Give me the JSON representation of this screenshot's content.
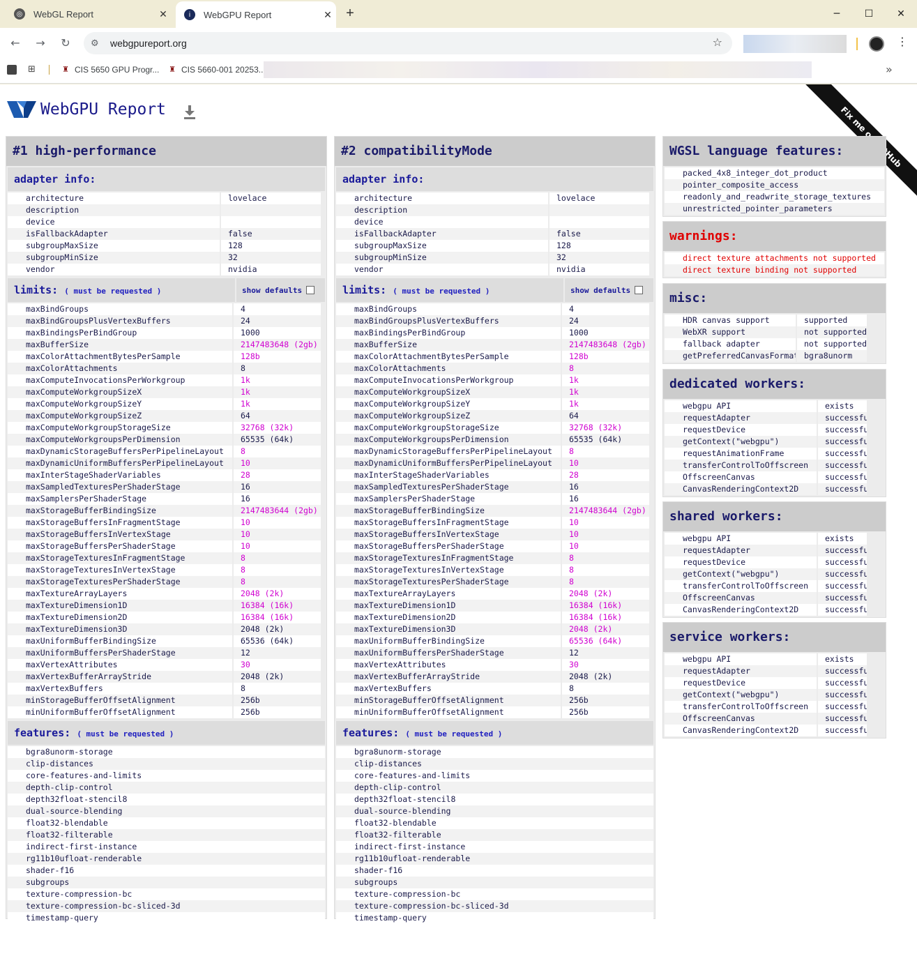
{
  "browser": {
    "tabs": [
      {
        "title": "WebGL Report",
        "active": false
      },
      {
        "title": "WebGPU Report",
        "active": true
      }
    ],
    "url": "webgpureport.org",
    "bookmarks": [
      {
        "label": "CIS 5650 GPU Progr..."
      },
      {
        "label": "CIS 5660-001 20253..."
      }
    ]
  },
  "page": {
    "title": "WebGPU Report",
    "ribbon": "Fix me on GitHub"
  },
  "adapters": [
    {
      "heading": "#1 high-performance",
      "adapter_info_label": "adapter info:",
      "adapter_info": [
        {
          "k": "architecture",
          "v": "lovelace"
        },
        {
          "k": "description",
          "v": ""
        },
        {
          "k": "device",
          "v": ""
        },
        {
          "k": "isFallbackAdapter",
          "v": "false"
        },
        {
          "k": "subgroupMaxSize",
          "v": "128"
        },
        {
          "k": "subgroupMinSize",
          "v": "32"
        },
        {
          "k": "vendor",
          "v": "nvidia"
        }
      ],
      "limits_label": "limits:",
      "must_be_requested": "( must be requested )",
      "show_defaults": "show defaults",
      "limits": [
        {
          "k": "maxBindGroups",
          "v": "4",
          "hl": false
        },
        {
          "k": "maxBindGroupsPlusVertexBuffers",
          "v": "24",
          "hl": false
        },
        {
          "k": "maxBindingsPerBindGroup",
          "v": "1000",
          "hl": false
        },
        {
          "k": "maxBufferSize",
          "v": "2147483648 (2gb)",
          "hl": true
        },
        {
          "k": "maxColorAttachmentBytesPerSample",
          "v": "128b",
          "hl": true
        },
        {
          "k": "maxColorAttachments",
          "v": "8",
          "hl": false
        },
        {
          "k": "maxComputeInvocationsPerWorkgroup",
          "v": "1k",
          "hl": true
        },
        {
          "k": "maxComputeWorkgroupSizeX",
          "v": "1k",
          "hl": true
        },
        {
          "k": "maxComputeWorkgroupSizeY",
          "v": "1k",
          "hl": true
        },
        {
          "k": "maxComputeWorkgroupSizeZ",
          "v": "64",
          "hl": false
        },
        {
          "k": "maxComputeWorkgroupStorageSize",
          "v": "32768 (32k)",
          "hl": true
        },
        {
          "k": "maxComputeWorkgroupsPerDimension",
          "v": "65535 (64k)",
          "hl": false
        },
        {
          "k": "maxDynamicStorageBuffersPerPipelineLayout",
          "v": "8",
          "hl": true
        },
        {
          "k": "maxDynamicUniformBuffersPerPipelineLayout",
          "v": "10",
          "hl": true
        },
        {
          "k": "maxInterStageShaderVariables",
          "v": "28",
          "hl": true
        },
        {
          "k": "maxSampledTexturesPerShaderStage",
          "v": "16",
          "hl": false
        },
        {
          "k": "maxSamplersPerShaderStage",
          "v": "16",
          "hl": false
        },
        {
          "k": "maxStorageBufferBindingSize",
          "v": "2147483644 (2gb)",
          "hl": true
        },
        {
          "k": "maxStorageBuffersInFragmentStage",
          "v": "10",
          "hl": true
        },
        {
          "k": "maxStorageBuffersInVertexStage",
          "v": "10",
          "hl": true
        },
        {
          "k": "maxStorageBuffersPerShaderStage",
          "v": "10",
          "hl": true
        },
        {
          "k": "maxStorageTexturesInFragmentStage",
          "v": "8",
          "hl": true
        },
        {
          "k": "maxStorageTexturesInVertexStage",
          "v": "8",
          "hl": true
        },
        {
          "k": "maxStorageTexturesPerShaderStage",
          "v": "8",
          "hl": true
        },
        {
          "k": "maxTextureArrayLayers",
          "v": "2048 (2k)",
          "hl": true
        },
        {
          "k": "maxTextureDimension1D",
          "v": "16384 (16k)",
          "hl": true
        },
        {
          "k": "maxTextureDimension2D",
          "v": "16384 (16k)",
          "hl": true
        },
        {
          "k": "maxTextureDimension3D",
          "v": "2048 (2k)",
          "hl": false
        },
        {
          "k": "maxUniformBufferBindingSize",
          "v": "65536 (64k)",
          "hl": false
        },
        {
          "k": "maxUniformBuffersPerShaderStage",
          "v": "12",
          "hl": false
        },
        {
          "k": "maxVertexAttributes",
          "v": "30",
          "hl": true
        },
        {
          "k": "maxVertexBufferArrayStride",
          "v": "2048 (2k)",
          "hl": false
        },
        {
          "k": "maxVertexBuffers",
          "v": "8",
          "hl": false
        },
        {
          "k": "minStorageBufferOffsetAlignment",
          "v": "256b",
          "hl": false
        },
        {
          "k": "minUniformBufferOffsetAlignment",
          "v": "256b",
          "hl": false
        }
      ],
      "features_label": "features:",
      "features": [
        "bgra8unorm-storage",
        "clip-distances",
        "core-features-and-limits",
        "depth-clip-control",
        "depth32float-stencil8",
        "dual-source-blending",
        "float32-blendable",
        "float32-filterable",
        "indirect-first-instance",
        "rg11b10ufloat-renderable",
        "shader-f16",
        "subgroups",
        "texture-compression-bc",
        "texture-compression-bc-sliced-3d",
        "timestamp-query"
      ]
    },
    {
      "heading": "#2 compatibilityMode",
      "adapter_info_label": "adapter info:",
      "adapter_info": [
        {
          "k": "architecture",
          "v": "lovelace"
        },
        {
          "k": "description",
          "v": ""
        },
        {
          "k": "device",
          "v": ""
        },
        {
          "k": "isFallbackAdapter",
          "v": "false"
        },
        {
          "k": "subgroupMaxSize",
          "v": "128"
        },
        {
          "k": "subgroupMinSize",
          "v": "32"
        },
        {
          "k": "vendor",
          "v": "nvidia"
        }
      ],
      "limits_label": "limits:",
      "must_be_requested": "( must be requested )",
      "show_defaults": "show defaults",
      "limits": [
        {
          "k": "maxBindGroups",
          "v": "4",
          "hl": false
        },
        {
          "k": "maxBindGroupsPlusVertexBuffers",
          "v": "24",
          "hl": false
        },
        {
          "k": "maxBindingsPerBindGroup",
          "v": "1000",
          "hl": false
        },
        {
          "k": "maxBufferSize",
          "v": "2147483648 (2gb)",
          "hl": true
        },
        {
          "k": "maxColorAttachmentBytesPerSample",
          "v": "128b",
          "hl": true
        },
        {
          "k": "maxColorAttachments",
          "v": "8",
          "hl": true
        },
        {
          "k": "maxComputeInvocationsPerWorkgroup",
          "v": "1k",
          "hl": true
        },
        {
          "k": "maxComputeWorkgroupSizeX",
          "v": "1k",
          "hl": true
        },
        {
          "k": "maxComputeWorkgroupSizeY",
          "v": "1k",
          "hl": true
        },
        {
          "k": "maxComputeWorkgroupSizeZ",
          "v": "64",
          "hl": false
        },
        {
          "k": "maxComputeWorkgroupStorageSize",
          "v": "32768 (32k)",
          "hl": true
        },
        {
          "k": "maxComputeWorkgroupsPerDimension",
          "v": "65535 (64k)",
          "hl": false
        },
        {
          "k": "maxDynamicStorageBuffersPerPipelineLayout",
          "v": "8",
          "hl": true
        },
        {
          "k": "maxDynamicUniformBuffersPerPipelineLayout",
          "v": "10",
          "hl": true
        },
        {
          "k": "maxInterStageShaderVariables",
          "v": "28",
          "hl": true
        },
        {
          "k": "maxSampledTexturesPerShaderStage",
          "v": "16",
          "hl": false
        },
        {
          "k": "maxSamplersPerShaderStage",
          "v": "16",
          "hl": false
        },
        {
          "k": "maxStorageBufferBindingSize",
          "v": "2147483644 (2gb)",
          "hl": true
        },
        {
          "k": "maxStorageBuffersInFragmentStage",
          "v": "10",
          "hl": true
        },
        {
          "k": "maxStorageBuffersInVertexStage",
          "v": "10",
          "hl": true
        },
        {
          "k": "maxStorageBuffersPerShaderStage",
          "v": "10",
          "hl": true
        },
        {
          "k": "maxStorageTexturesInFragmentStage",
          "v": "8",
          "hl": true
        },
        {
          "k": "maxStorageTexturesInVertexStage",
          "v": "8",
          "hl": true
        },
        {
          "k": "maxStorageTexturesPerShaderStage",
          "v": "8",
          "hl": true
        },
        {
          "k": "maxTextureArrayLayers",
          "v": "2048 (2k)",
          "hl": true
        },
        {
          "k": "maxTextureDimension1D",
          "v": "16384 (16k)",
          "hl": true
        },
        {
          "k": "maxTextureDimension2D",
          "v": "16384 (16k)",
          "hl": true
        },
        {
          "k": "maxTextureDimension3D",
          "v": "2048 (2k)",
          "hl": true
        },
        {
          "k": "maxUniformBufferBindingSize",
          "v": "65536 (64k)",
          "hl": true
        },
        {
          "k": "maxUniformBuffersPerShaderStage",
          "v": "12",
          "hl": false
        },
        {
          "k": "maxVertexAttributes",
          "v": "30",
          "hl": true
        },
        {
          "k": "maxVertexBufferArrayStride",
          "v": "2048 (2k)",
          "hl": false
        },
        {
          "k": "maxVertexBuffers",
          "v": "8",
          "hl": false
        },
        {
          "k": "minStorageBufferOffsetAlignment",
          "v": "256b",
          "hl": false
        },
        {
          "k": "minUniformBufferOffsetAlignment",
          "v": "256b",
          "hl": false
        }
      ],
      "features_label": "features:",
      "features": [
        "bgra8unorm-storage",
        "clip-distances",
        "core-features-and-limits",
        "depth-clip-control",
        "depth32float-stencil8",
        "dual-source-blending",
        "float32-blendable",
        "float32-filterable",
        "indirect-first-instance",
        "rg11b10ufloat-renderable",
        "shader-f16",
        "subgroups",
        "texture-compression-bc",
        "texture-compression-bc-sliced-3d",
        "timestamp-query"
      ]
    }
  ],
  "wgsl": {
    "heading": "WGSL language features:",
    "items": [
      "packed_4x8_integer_dot_product",
      "pointer_composite_access",
      "readonly_and_readwrite_storage_textures",
      "unrestricted_pointer_parameters"
    ]
  },
  "warnings": {
    "heading": "warnings:",
    "items": [
      "direct texture attachments not supported",
      "direct texture binding not supported"
    ]
  },
  "misc": {
    "heading": "misc:",
    "items": [
      {
        "k": "HDR canvas support",
        "v": "supported"
      },
      {
        "k": "WebXR support",
        "v": "not supported"
      },
      {
        "k": "fallback adapter",
        "v": "not supported"
      },
      {
        "k": "getPreferredCanvasFormat",
        "v": "bgra8unorm"
      }
    ]
  },
  "dedicated_workers": {
    "heading": "dedicated workers:",
    "items": [
      {
        "k": "webgpu API",
        "v": "exists"
      },
      {
        "k": "requestAdapter",
        "v": "successful"
      },
      {
        "k": "requestDevice",
        "v": "successful"
      },
      {
        "k": "getContext(\"webgpu\")",
        "v": "successful"
      },
      {
        "k": "requestAnimationFrame",
        "v": "successful"
      },
      {
        "k": "transferControlToOffscreen",
        "v": "successful"
      },
      {
        "k": "OffscreenCanvas",
        "v": "successful"
      },
      {
        "k": "CanvasRenderingContext2D",
        "v": "successful"
      }
    ]
  },
  "shared_workers": {
    "heading": "shared workers:",
    "items": [
      {
        "k": "webgpu API",
        "v": "exists"
      },
      {
        "k": "requestAdapter",
        "v": "successful"
      },
      {
        "k": "requestDevice",
        "v": "successful"
      },
      {
        "k": "getContext(\"webgpu\")",
        "v": "successful"
      },
      {
        "k": "transferControlToOffscreen",
        "v": "successful"
      },
      {
        "k": "OffscreenCanvas",
        "v": "successful"
      },
      {
        "k": "CanvasRenderingContext2D",
        "v": "successful"
      }
    ]
  },
  "service_workers": {
    "heading": "service workers:",
    "items": [
      {
        "k": "webgpu API",
        "v": "exists"
      },
      {
        "k": "requestAdapter",
        "v": "successful"
      },
      {
        "k": "requestDevice",
        "v": "successful"
      },
      {
        "k": "getContext(\"webgpu\")",
        "v": "successful"
      },
      {
        "k": "transferControlToOffscreen",
        "v": "successful"
      },
      {
        "k": "OffscreenCanvas",
        "v": "successful"
      },
      {
        "k": "CanvasRenderingContext2D",
        "v": "successful"
      }
    ]
  },
  "colors": {
    "highlight": "#d000d0",
    "warning": "#e00000",
    "heading": "#1a1a6a"
  }
}
